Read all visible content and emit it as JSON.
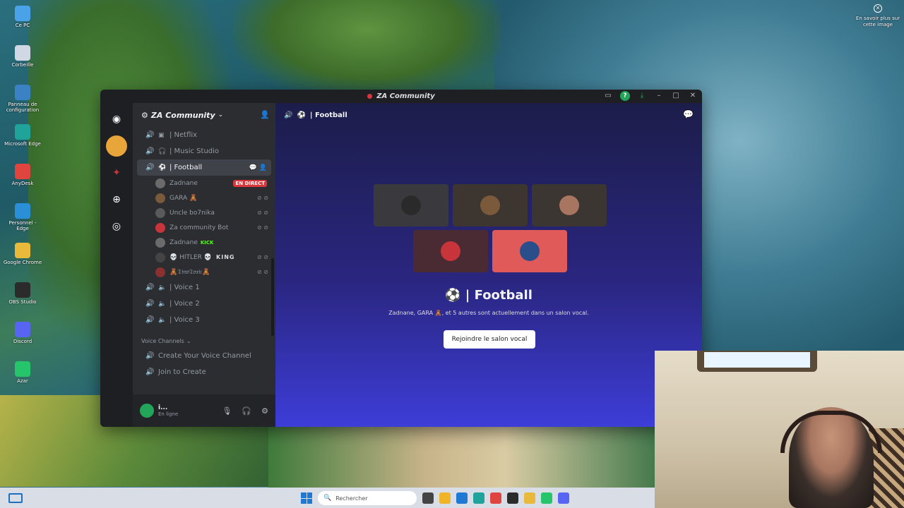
{
  "desktop": {
    "icons": [
      {
        "label": "Ce PC",
        "color": "#4aa3e8"
      },
      {
        "label": "Corbeille",
        "color": "#cfd8e3"
      },
      {
        "label": "Panneau de configuration",
        "color": "#3b82c4"
      },
      {
        "label": "Microsoft Edge",
        "color": "#1fa39a"
      },
      {
        "label": "AnyDesk",
        "color": "#e0443e"
      },
      {
        "label": "Personnel - Edge",
        "color": "#2a8fd6"
      },
      {
        "label": "Google Chrome",
        "color": "#e8b93a"
      },
      {
        "label": "OBS Studio",
        "color": "#2b2b2b"
      },
      {
        "label": "Discord",
        "color": "#5865f2"
      },
      {
        "label": "Azar",
        "color": "#26c46b"
      }
    ],
    "learn_more": "En savoir plus sur cette image"
  },
  "window": {
    "title": "ZA Community"
  },
  "server": {
    "name": "ZA Community"
  },
  "channels": [
    {
      "name": "| Netflix",
      "icon": "netflix-icon"
    },
    {
      "name": "| Music Studio",
      "icon": "headphones-icon"
    },
    {
      "name": "| Football",
      "icon": "soccer-ball-icon",
      "active": true
    }
  ],
  "voice_users": [
    {
      "name": "Zadnane",
      "badge": "EN DIRECT",
      "avatar_color": "#6b6b6b"
    },
    {
      "name": "GARA 🧸",
      "avatar_color": "#7a5a3a"
    },
    {
      "name": "Uncle bo7nika",
      "avatar_color": "#5a5a5a"
    },
    {
      "name": "Za community Bot",
      "avatar_color": "#c7343a"
    },
    {
      "name": "Zadnane",
      "badge": "KICK",
      "avatar_color": "#6b6b6b"
    },
    {
      "name": "💀 HITLER 💀",
      "badge": "KING",
      "avatar_color": "#444"
    },
    {
      "name": "🧸𝔗𝔦𝔫𝔬𝔗𝔬𝔵𝔦𝔠🧸",
      "avatar_color": "#8a3030"
    }
  ],
  "voice_channels_more": [
    {
      "name": "| Voice 1"
    },
    {
      "name": "| Voice 2"
    },
    {
      "name": "| Voice 3"
    }
  ],
  "category": {
    "label": "Voice Channels"
  },
  "category_channels": [
    {
      "name": "Create Your Voice Channel"
    },
    {
      "name": "Join to Create"
    }
  ],
  "user_panel": {
    "name": "i...",
    "status": "En ligne"
  },
  "main": {
    "header_channel": "| Football",
    "vc_title": "| Football",
    "vc_subtitle": "Zadnane, GARA 🧸, et 5 autres sont actuellement dans un salon vocal.",
    "join_label": "Rejoindre le salon vocal",
    "tiles": [
      {
        "bg": "#3a3a3e",
        "avatar": "#2a2a2a"
      },
      {
        "bg": "#3d3530",
        "avatar": "#7a5a3a"
      },
      {
        "bg": "#3b3632",
        "avatar": "#a87660"
      },
      {
        "bg": "#4a2a33",
        "avatar": "#c7343a"
      },
      {
        "bg": "#e05a5a",
        "avatar": "#2a4e8a"
      }
    ]
  },
  "taskbar": {
    "search_placeholder": "Rechercher",
    "apps": [
      {
        "icon": "task-view-icon",
        "color": "#444"
      },
      {
        "icon": "file-explorer-icon",
        "color": "#f0b429"
      },
      {
        "icon": "store-icon",
        "color": "#1f78d1"
      },
      {
        "icon": "edge-icon",
        "color": "#1fa39a"
      },
      {
        "icon": "anydesk-icon",
        "color": "#e0443e"
      },
      {
        "icon": "obs-icon",
        "color": "#2b2b2b"
      },
      {
        "icon": "chrome-icon",
        "color": "#e8b93a"
      },
      {
        "icon": "azar-icon",
        "color": "#26c46b"
      },
      {
        "icon": "discord-icon",
        "color": "#5865f2"
      }
    ]
  }
}
